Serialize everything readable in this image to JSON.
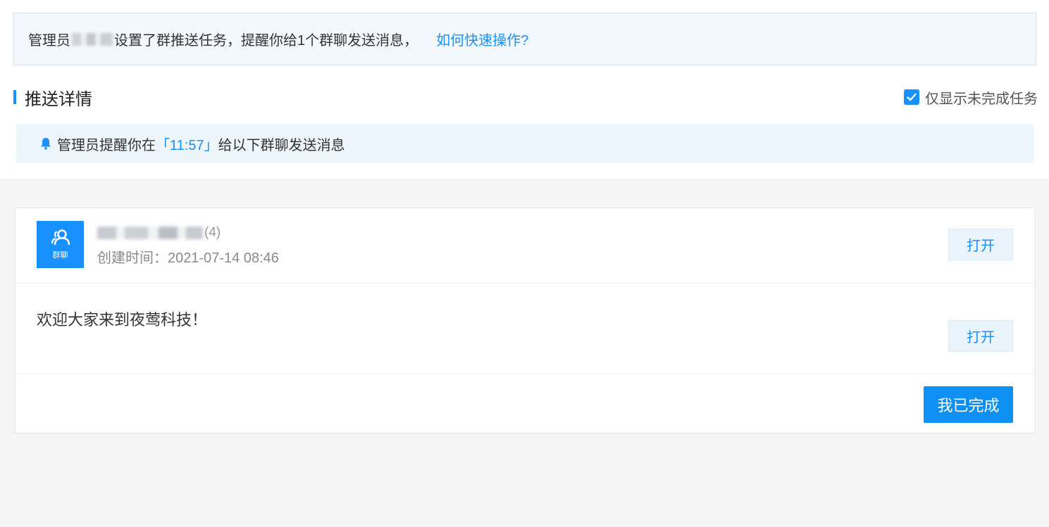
{
  "notice": {
    "prefix": "管理员",
    "suffix": "设置了群推送任务，提醒你给1个群聊发送消息，",
    "link": "如何快速操作?"
  },
  "section": {
    "title": "推送详情",
    "filter_label": "仅显示未完成任务",
    "filter_checked": true
  },
  "reminder": {
    "prefix": "管理员提醒你在",
    "time": "「11:57」",
    "suffix": "给以下群聊发送消息"
  },
  "card": {
    "avatar_label": "群聊",
    "member_count": "(4)",
    "created_label": "创建时间：",
    "created_at": "2021-07-14 08:46",
    "open_label": "打开",
    "message": "欢迎大家来到夜莺科技！",
    "message_open_label": "打开",
    "done_label": "我已完成"
  },
  "colors": {
    "accent": "#1890ff",
    "notice_bg": "#f3f8fe",
    "reminder_bg": "#edf5fd"
  },
  "icons": {
    "checkbox": "check-icon",
    "bell": "bell-icon",
    "avatar": "group-icon"
  }
}
